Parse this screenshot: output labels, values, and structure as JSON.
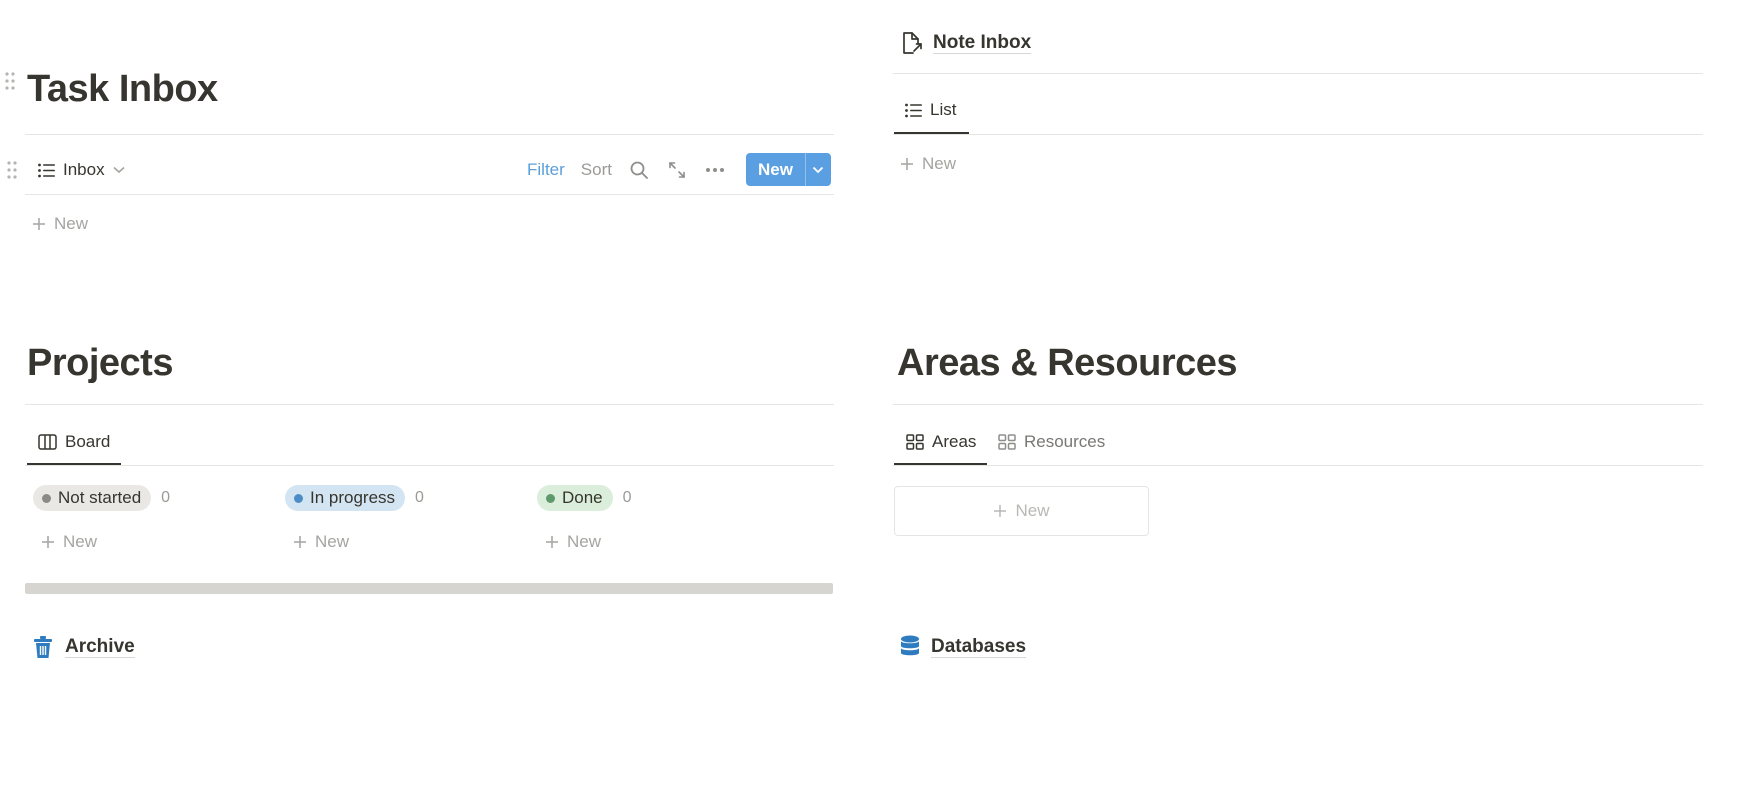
{
  "task_inbox": {
    "title": "Task Inbox",
    "view": {
      "label": "Inbox",
      "icon": "list-icon"
    },
    "toolbar": {
      "filter": "Filter",
      "sort": "Sort",
      "new_label": "New",
      "accent": "#5b9fe3"
    },
    "add_new": "New"
  },
  "note_inbox": {
    "title": "Note Inbox",
    "icon": "page-link-arrow-icon",
    "tab": "List",
    "add_new": "New"
  },
  "projects": {
    "title": "Projects",
    "tab": "Board",
    "columns": [
      {
        "label": "Not started",
        "count": "0",
        "new": "New",
        "pill_bg": "#e9e8e5",
        "dot": "#8b8a86"
      },
      {
        "label": "In progress",
        "count": "0",
        "new": "New",
        "pill_bg": "#d3e5f2",
        "dot": "#4d8dc6"
      },
      {
        "label": "Done",
        "count": "0",
        "new": "New",
        "pill_bg": "#dbeddb",
        "dot": "#5e9a6b"
      }
    ]
  },
  "areas_resources": {
    "title": "Areas & Resources",
    "tabs": [
      "Areas",
      "Resources"
    ],
    "add_new": "New"
  },
  "archive": {
    "title": "Archive",
    "icon": "trash-icon",
    "icon_color": "#2f7bbf"
  },
  "databases": {
    "title": "Databases",
    "icon": "database-icon",
    "icon_color": "#2f7bbf"
  }
}
